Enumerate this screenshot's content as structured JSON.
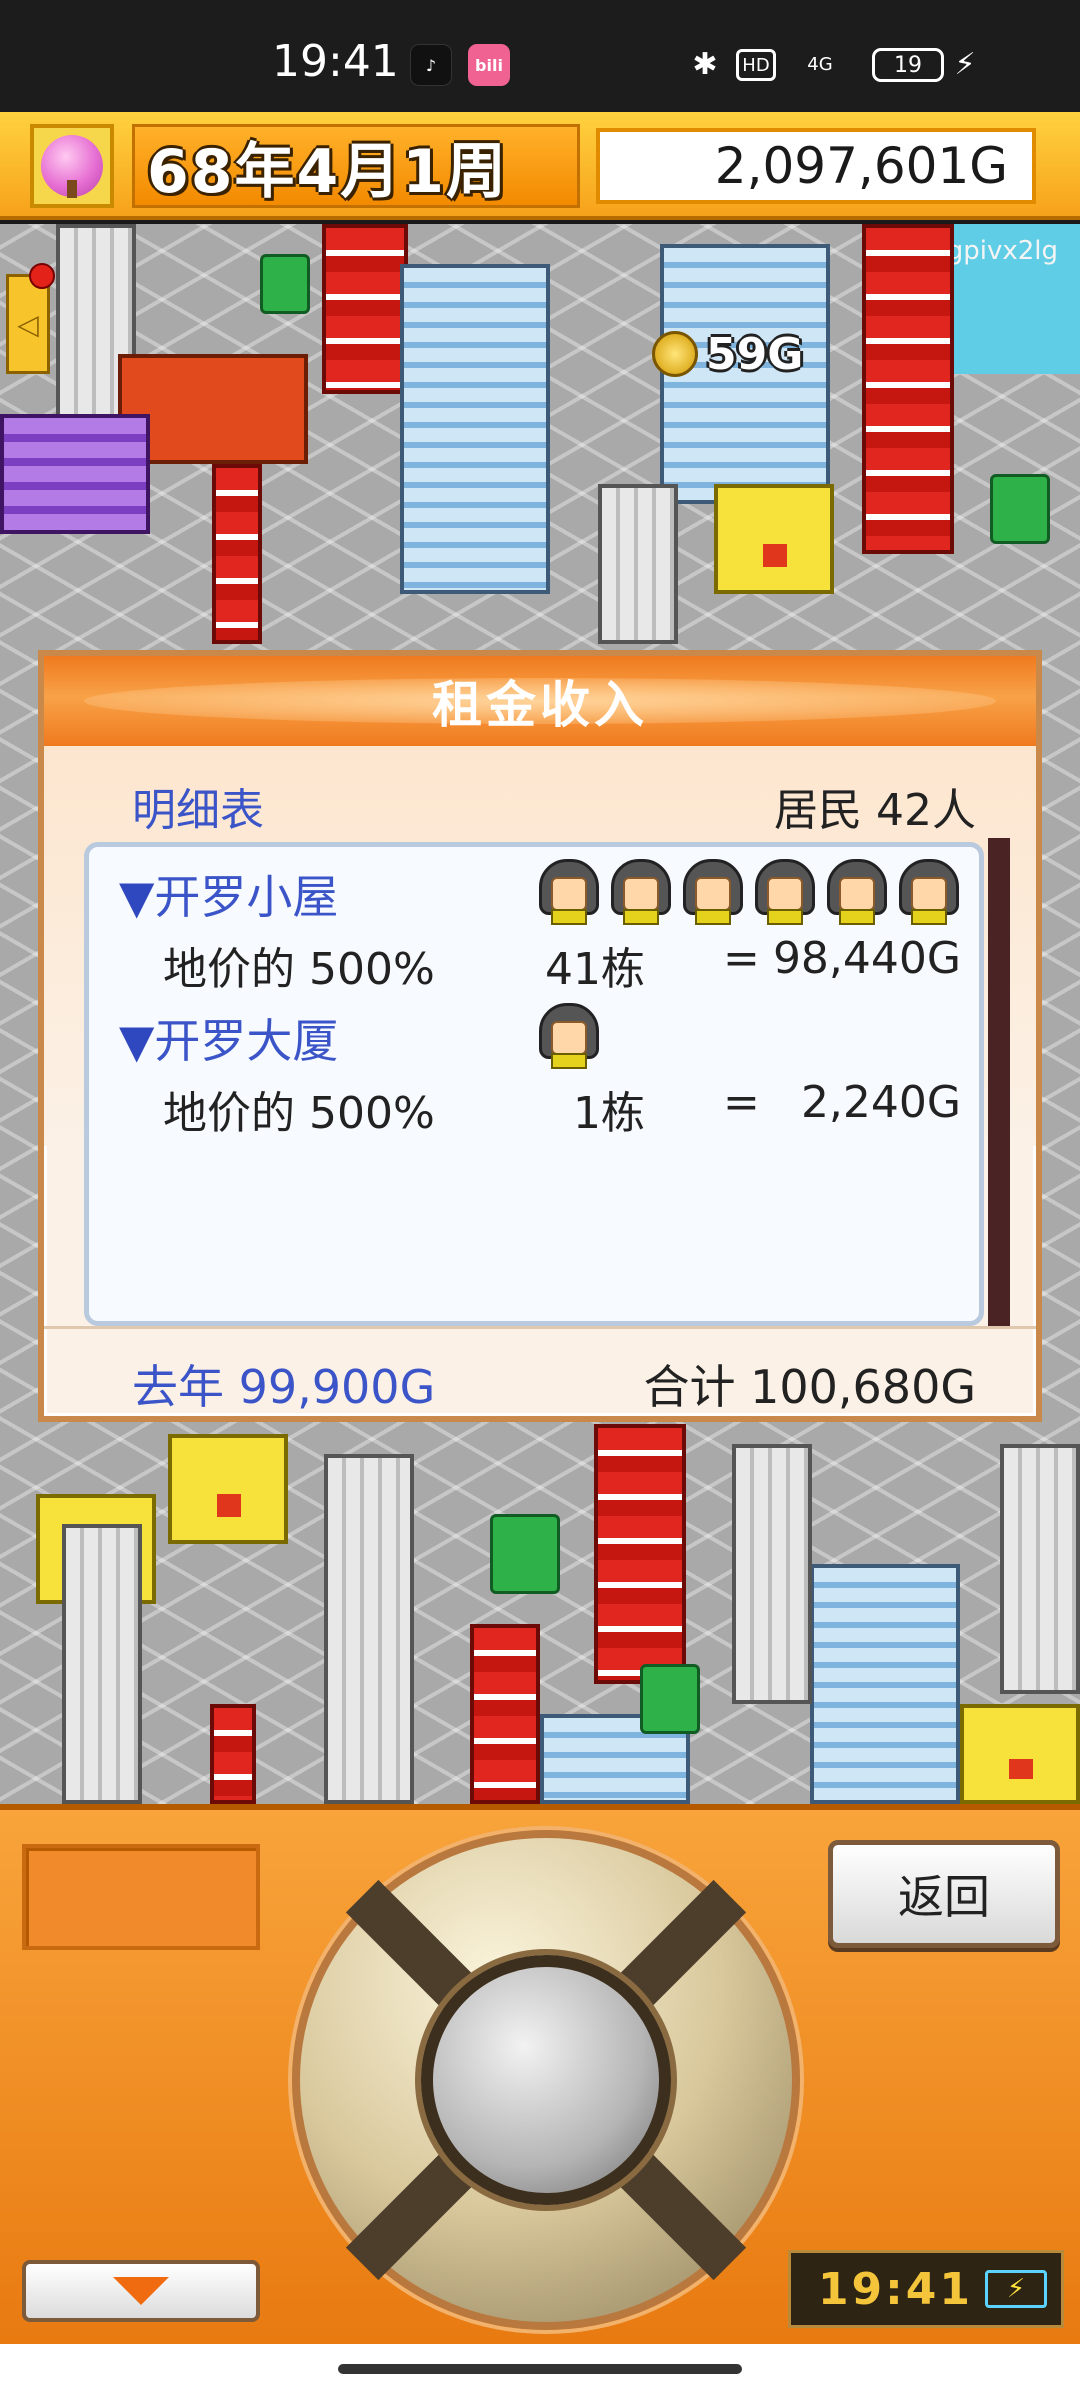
{
  "status_bar": {
    "time": "19:41",
    "apps": {
      "tiktok": "♪",
      "bilibili": "bili"
    },
    "icons": {
      "bluetooth": "✱",
      "hd": "HD",
      "signal": "4G",
      "battery": "19",
      "charging": "⚡"
    }
  },
  "game_header": {
    "date": "68年4月1周",
    "money": "2,097,601G"
  },
  "scene": {
    "watermark": "gpivx2lg",
    "coin_income": "59G",
    "left_tab_icon": "◁"
  },
  "dialog": {
    "title": "租金收入",
    "detail_label": "明细表",
    "residents": "居民 42人",
    "entries": [
      {
        "name": "开罗小屋",
        "rate": "地价的 500%",
        "count": "41栋",
        "eq": "=",
        "amount": "98,440G",
        "faces": 6
      },
      {
        "name": "开罗大厦",
        "rate": "地价的 500%",
        "count": "1栋",
        "eq": "=",
        "amount": "2,240G",
        "faces": 1
      }
    ],
    "last_year": "去年 99,900G",
    "total": "合计 100,680G"
  },
  "controller": {
    "back_label": "返回",
    "clock": "19:41",
    "clock_battery_icon": "⚡"
  },
  "colors": {
    "accent_orange": "#f07a1e",
    "link_blue": "#3b55c9",
    "clock_gold": "#f4c53a"
  }
}
